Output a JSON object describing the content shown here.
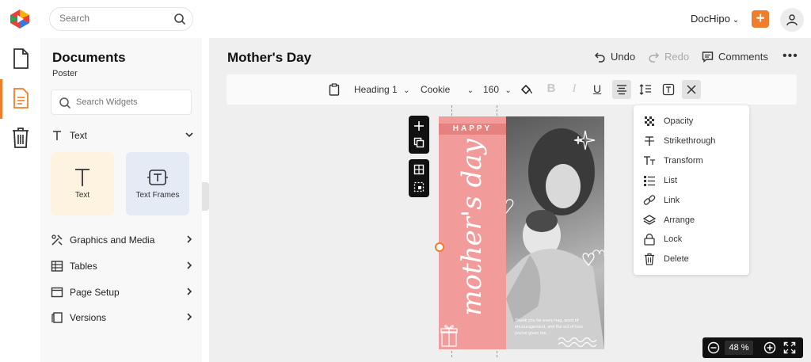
{
  "topbar": {
    "search_placeholder": "Search",
    "brand": "DocHipo",
    "plus_label": "+"
  },
  "panel": {
    "title": "Documents",
    "subtitle": "Poster",
    "search_placeholder": "Search Widgets",
    "sections": {
      "text": "Text",
      "graphics": "Graphics and Media",
      "tables": "Tables",
      "page_setup": "Page Setup",
      "versions": "Versions"
    },
    "cards": {
      "text": "Text",
      "text_frames": "Text Frames"
    }
  },
  "editor": {
    "doc_title": "Mother's Day",
    "undo": "Undo",
    "redo": "Redo",
    "comments": "Comments",
    "more": "•••",
    "toolbar": {
      "heading": "Heading 1",
      "font": "Cookie",
      "size": "160",
      "bold": "B",
      "italic": "I",
      "underline": "U"
    }
  },
  "poster": {
    "happy": "HAPPY",
    "script": "mother's day",
    "caption": "Thank you for every hug, word of encouragement, and the act of love you've given me."
  },
  "context_menu": {
    "opacity": "Opacity",
    "strikethrough": "Strikethrough",
    "transform": "Transform",
    "list": "List",
    "link": "Link",
    "arrange": "Arrange",
    "lock": "Lock",
    "delete": "Delete"
  },
  "zoom": {
    "value": "48",
    "unit": "%"
  },
  "colors": {
    "accent": "#f07d2b",
    "poster_pink": "#f19c9a"
  }
}
